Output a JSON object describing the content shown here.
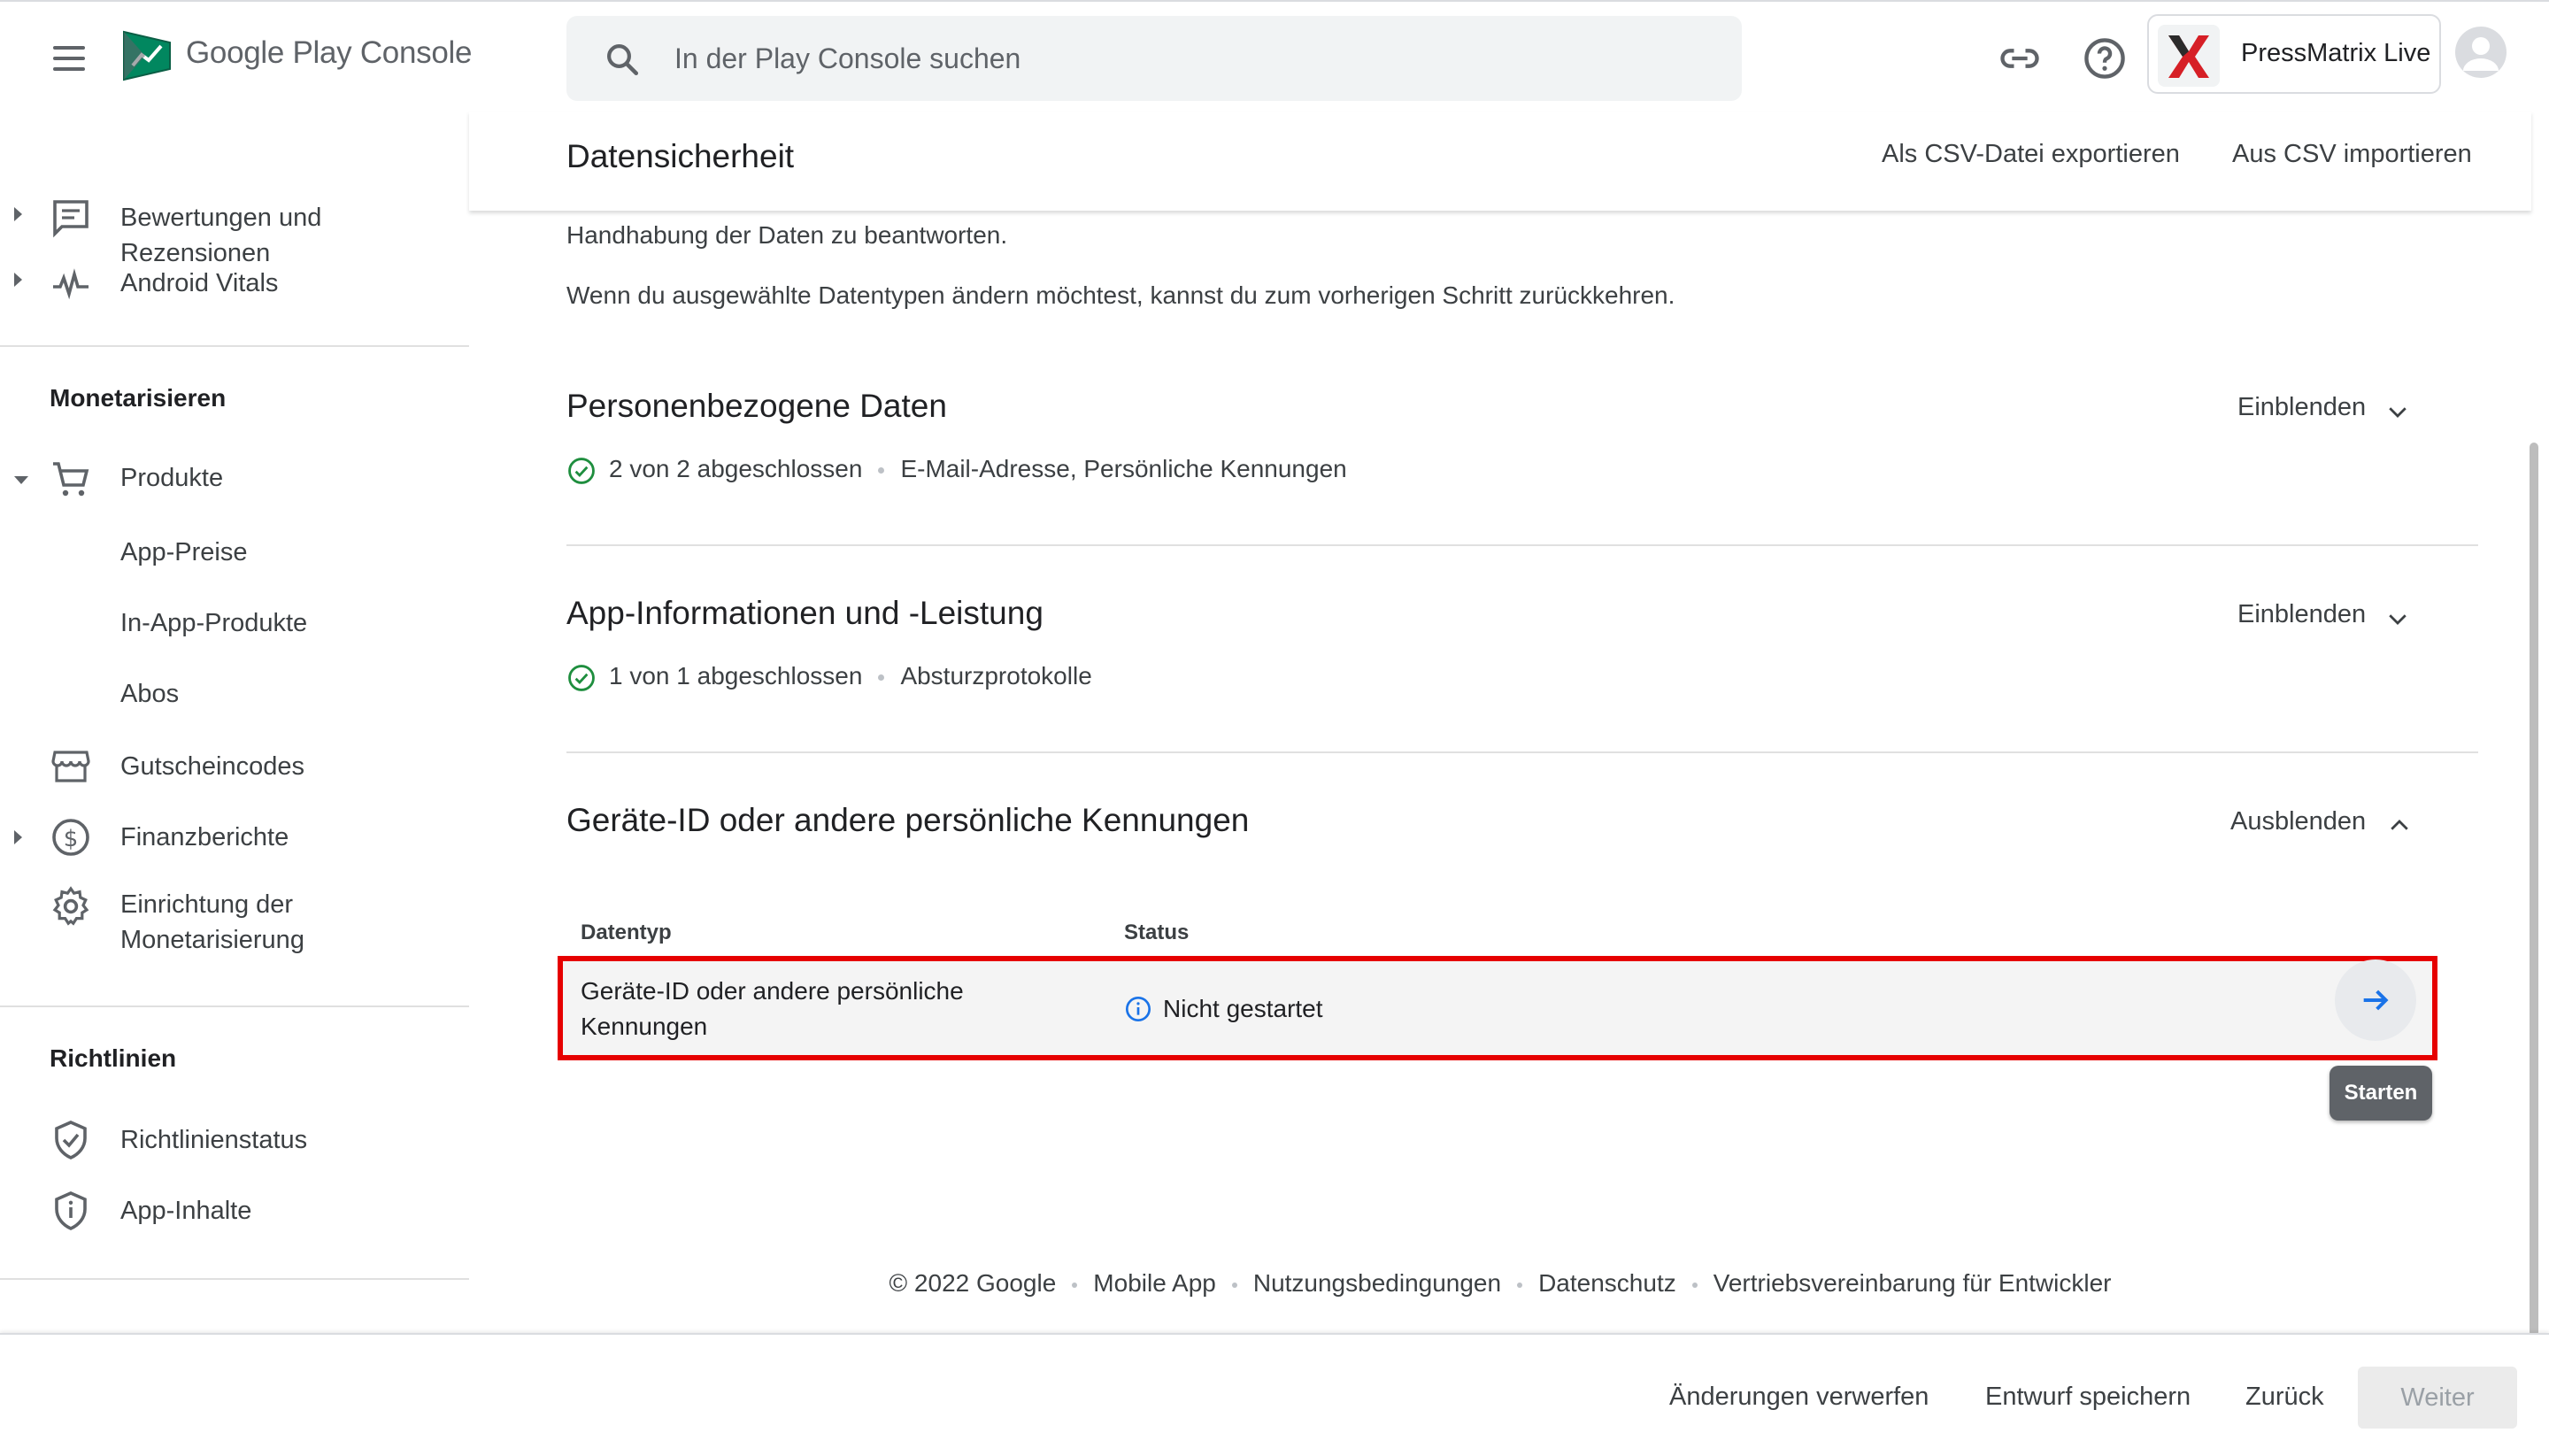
{
  "topbar": {
    "brand_google": "Google Play",
    "brand_console": "Console",
    "search_placeholder": "In der Play Console suchen",
    "app_name": "PressMatrix Live"
  },
  "sidebar": {
    "items_top": [
      {
        "label": "Bewertungen und Rezensionen",
        "icon": "reviews-icon"
      },
      {
        "label": "Android Vitals",
        "icon": "vitals-icon"
      }
    ],
    "section_monetize": "Monetarisieren",
    "monetize_items": {
      "products": "Produkte",
      "app_prices": "App-Preise",
      "in_app_products": "In-App-Produkte",
      "subscriptions": "Abos",
      "promo_codes": "Gutscheincodes",
      "financial_reports": "Finanzberichte",
      "monetization_setup": "Einrichtung der Monetarisierung"
    },
    "section_policy": "Richtlinien",
    "policy_items": {
      "policy_status": "Richtlinienstatus",
      "app_content": "App-Inhalte"
    }
  },
  "header": {
    "title": "Datensicherheit",
    "export_csv": "Als CSV-Datei exportieren",
    "import_csv": "Aus CSV importieren"
  },
  "main": {
    "intro_line1": "Handhabung der Daten zu beantworten.",
    "intro_line2": "Wenn du ausgewählte Datentypen ändern möchtest, kannst du zum vorherigen Schritt zurückkehren.",
    "sections": [
      {
        "title": "Personenbezogene Daten",
        "toggle": "Einblenden",
        "progress": "2 von 2 abgeschlossen",
        "types": "E-Mail-Adresse, Persönliche Kennungen"
      },
      {
        "title": "App-Informationen und -Leistung",
        "toggle": "Einblenden",
        "progress": "1 von 1 abgeschlossen",
        "types": "Absturzprotokolle"
      },
      {
        "title": "Geräte-ID oder andere persönliche Kennungen",
        "toggle": "Ausblenden"
      }
    ],
    "table": {
      "col_type": "Datentyp",
      "col_status": "Status",
      "row_type": "Geräte-ID oder andere persönliche Kennungen",
      "row_status": "Nicht gestartet",
      "tooltip": "Starten"
    }
  },
  "footer": {
    "copyright": "© 2022 Google",
    "links": [
      "Mobile App",
      "Nutzungsbedingungen",
      "Datenschutz",
      "Vertriebsvereinbarung für Entwickler"
    ]
  },
  "bottombar": {
    "discard": "Änderungen verwerfen",
    "save_draft": "Entwurf speichern",
    "back": "Zurück",
    "next": "Weiter"
  },
  "colors": {
    "accent": "#1a73e8",
    "success": "#1e8e3e",
    "highlight": "#e60000"
  }
}
